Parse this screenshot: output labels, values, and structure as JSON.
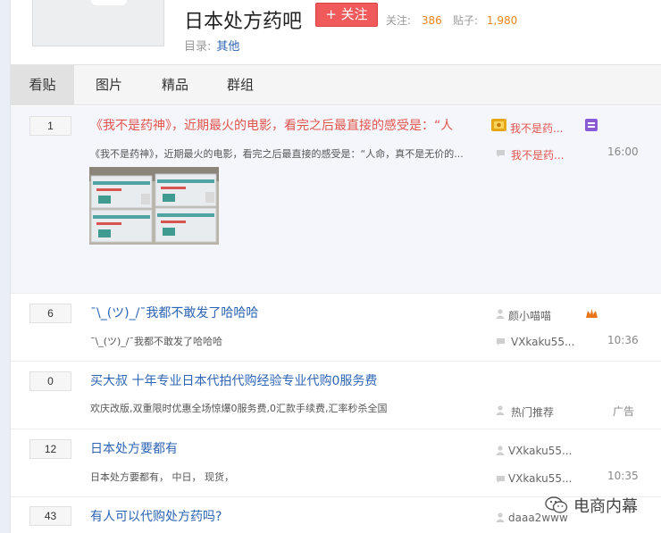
{
  "header": {
    "forum_title": "日本处方药吧",
    "follow_label": "+ 关注",
    "follow_stat_label": "关注:",
    "follow_count": "386",
    "post_stat_label": "贴子:",
    "post_count": "1,980",
    "catalog_label": "目录:",
    "catalog_value": "其他"
  },
  "tabs": [
    {
      "label": "看贴"
    },
    {
      "label": "图片"
    },
    {
      "label": "精品"
    },
    {
      "label": "群组"
    }
  ],
  "threads": [
    {
      "replies": "1",
      "title": "《我不是药神》，近期最火的电影，看完之后最直接的感受是：“人",
      "abstract": "《我不是药神》，近期最火的电影，看完之后最直接的感受是：“人命，真不是无价的...",
      "author": "我不是药...",
      "last_reply": "我不是药...",
      "time": "16:00"
    },
    {
      "replies": "6",
      "title": "¯\\_(ツ)_/¯我都不敢发了哈哈哈",
      "abstract": "¯\\_(ツ)_/¯我都不敢发了哈哈哈",
      "author": "颜小喵喵",
      "last_reply": "VXkaku55...",
      "time": "10:36"
    },
    {
      "replies": "0",
      "title": "买大叔 十年专业日本代拍代购经验专业代购0服务费",
      "abstract": "欢庆改版,双重限时优惠全场惊爆0服务费,0汇款手续费,汇率秒杀全国",
      "author": "热门推荐",
      "time": "广告"
    },
    {
      "replies": "12",
      "title": "日本处方要都有",
      "abstract": "日本处方要都有， 中日， 现货，",
      "author": "VXkaku55...",
      "last_reply": "VXkaku55...",
      "time": "10:35"
    },
    {
      "replies": "43",
      "title": "有人可以代购处方药吗?",
      "author": "daaa2www"
    }
  ],
  "watermark": "电商内幕",
  "colors": {
    "link_blue": "#2d64b3",
    "hot_red": "#e2554f",
    "follow_red": "#f05a5a",
    "count_orange": "#e8851d"
  },
  "icons": {
    "author": "person-icon",
    "last_reply": "speech-bubble-icon",
    "badge_gold": "gold-badge-icon",
    "badge_purple": "purple-badge-icon",
    "badge_orange": "orange-badge-icon",
    "watermark": "wechat-icon"
  }
}
